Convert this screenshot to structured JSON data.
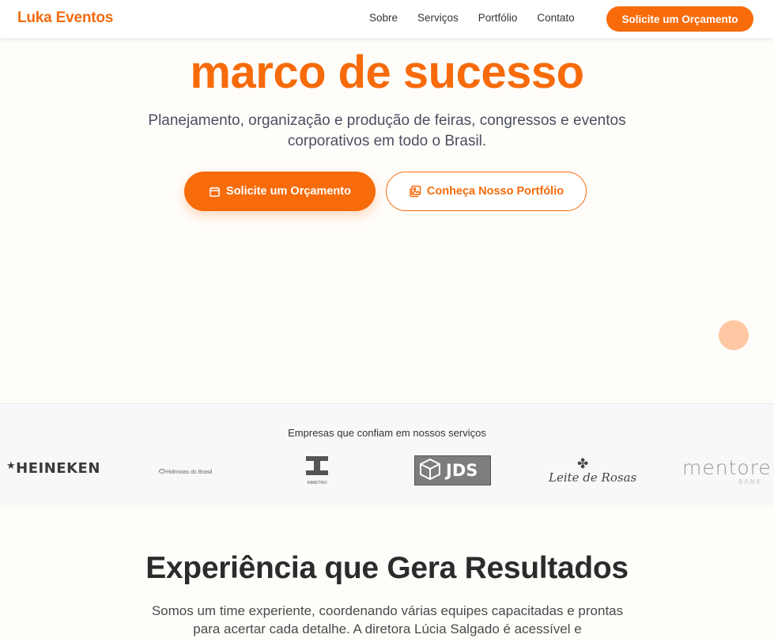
{
  "header": {
    "brand": "Luka Eventos",
    "nav": [
      "Sobre",
      "Serviços",
      "Portfólio",
      "Contato"
    ],
    "cta": "Solicite um Orçamento"
  },
  "hero": {
    "title": "marco de sucesso",
    "subtitle": "Planejamento, organização e produção de feiras, congressos e eventos corporativos em todo o Brasil.",
    "primary_button": "Solicite um Orçamento",
    "secondary_button": "Conheça Nosso Portfólio"
  },
  "clients": {
    "title": "Empresas que confiam em nossos serviços",
    "logos": {
      "heineken": "HEINEKEN",
      "hidrovias": "Hidrovias do Brasil",
      "inmetro": "INMETRO",
      "jds": "JDS",
      "leite_de_rosas": "Leite de Rosas",
      "mentore": "mentore",
      "mentore_sub": "BANK"
    }
  },
  "experience": {
    "title": "Experiência que Gera Resultados",
    "text": "Somos um time experiente, coordenando várias equipes capacitadas e prontas para acertar cada detalhe. A diretora Lúcia Salgado é acessível e"
  },
  "colors": {
    "accent": "#f76b0b",
    "brand": "#f26b0f",
    "floating_circle": "#ffc8a3"
  }
}
